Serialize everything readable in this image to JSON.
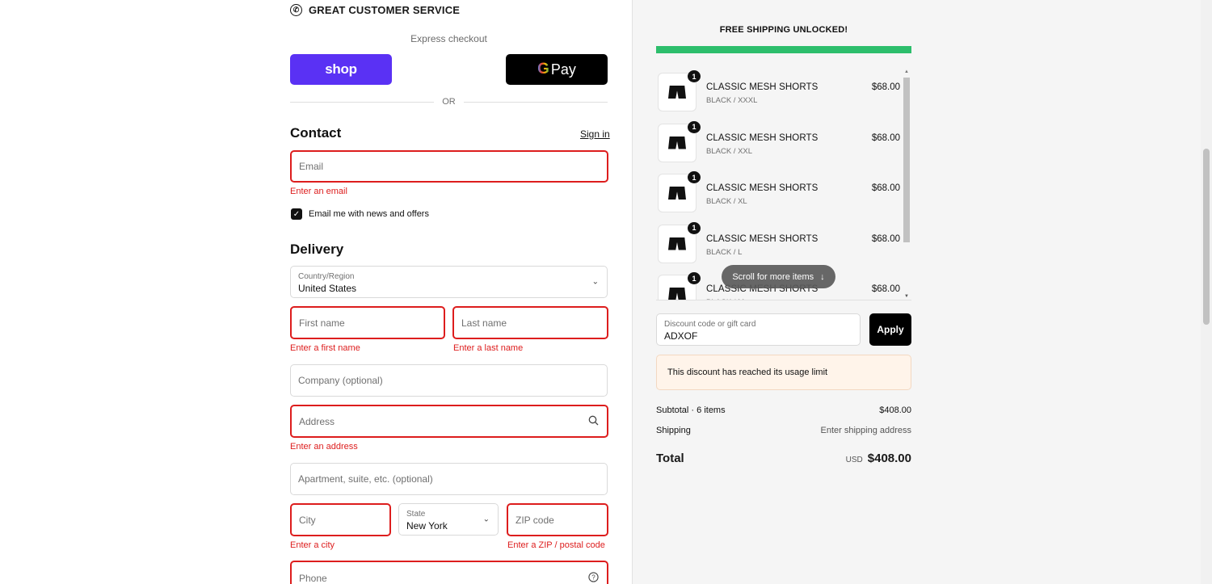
{
  "header": {
    "service_text": "GREAT CUSTOMER SERVICE",
    "service_icon": "shield-icon"
  },
  "express": {
    "label": "Express checkout",
    "shop_label": "shop",
    "gpay_g": "G",
    "gpay_label": "Pay",
    "or_label": "OR"
  },
  "contact": {
    "title": "Contact",
    "sign_in": "Sign in",
    "email_placeholder": "Email",
    "email_error": "Enter an email",
    "newsletter_label": "Email me with news and offers",
    "newsletter_checked": true
  },
  "delivery": {
    "title": "Delivery",
    "country_label": "Country/Region",
    "country_value": "United States",
    "first_name_placeholder": "First name",
    "first_name_error": "Enter a first name",
    "last_name_placeholder": "Last name",
    "last_name_error": "Enter a last name",
    "company_placeholder": "Company (optional)",
    "address_placeholder": "Address",
    "address_error": "Enter an address",
    "apartment_placeholder": "Apartment, suite, etc. (optional)",
    "city_placeholder": "City",
    "city_error": "Enter a city",
    "state_label": "State",
    "state_value": "New York",
    "zip_placeholder": "ZIP code",
    "zip_error": "Enter a ZIP / postal code",
    "phone_placeholder": "Phone"
  },
  "summary": {
    "shipping_banner": "FREE SHIPPING UNLOCKED!",
    "shipping_progress": 1.0,
    "items": [
      {
        "qty": "1",
        "name": "CLASSIC MESH SHORTS",
        "variant": "BLACK / XXXL",
        "price": "$68.00"
      },
      {
        "qty": "1",
        "name": "CLASSIC MESH SHORTS",
        "variant": "BLACK / XXL",
        "price": "$68.00"
      },
      {
        "qty": "1",
        "name": "CLASSIC MESH SHORTS",
        "variant": "BLACK / XL",
        "price": "$68.00"
      },
      {
        "qty": "1",
        "name": "CLASSIC MESH SHORTS",
        "variant": "BLACK / L",
        "price": "$68.00"
      },
      {
        "qty": "1",
        "name": "CLASSIC MESH SHORTS",
        "variant": "BLACK / M",
        "price": "$68.00"
      }
    ],
    "scroll_hint": "Scroll for more items",
    "discount_label": "Discount code or gift card",
    "discount_value": "ADXOF",
    "apply_label": "Apply",
    "discount_notice": "This discount has reached its usage limit",
    "subtotal_label": "Subtotal · 6 items",
    "subtotal_value": "$408.00",
    "shipping_label": "Shipping",
    "shipping_value": "Enter shipping address",
    "total_label": "Total",
    "total_currency": "USD",
    "total_value": "$408.00"
  },
  "colors": {
    "error": "#dd1d1d",
    "shop_purple": "#5a31f4",
    "progress_green": "#2dbe6c"
  }
}
